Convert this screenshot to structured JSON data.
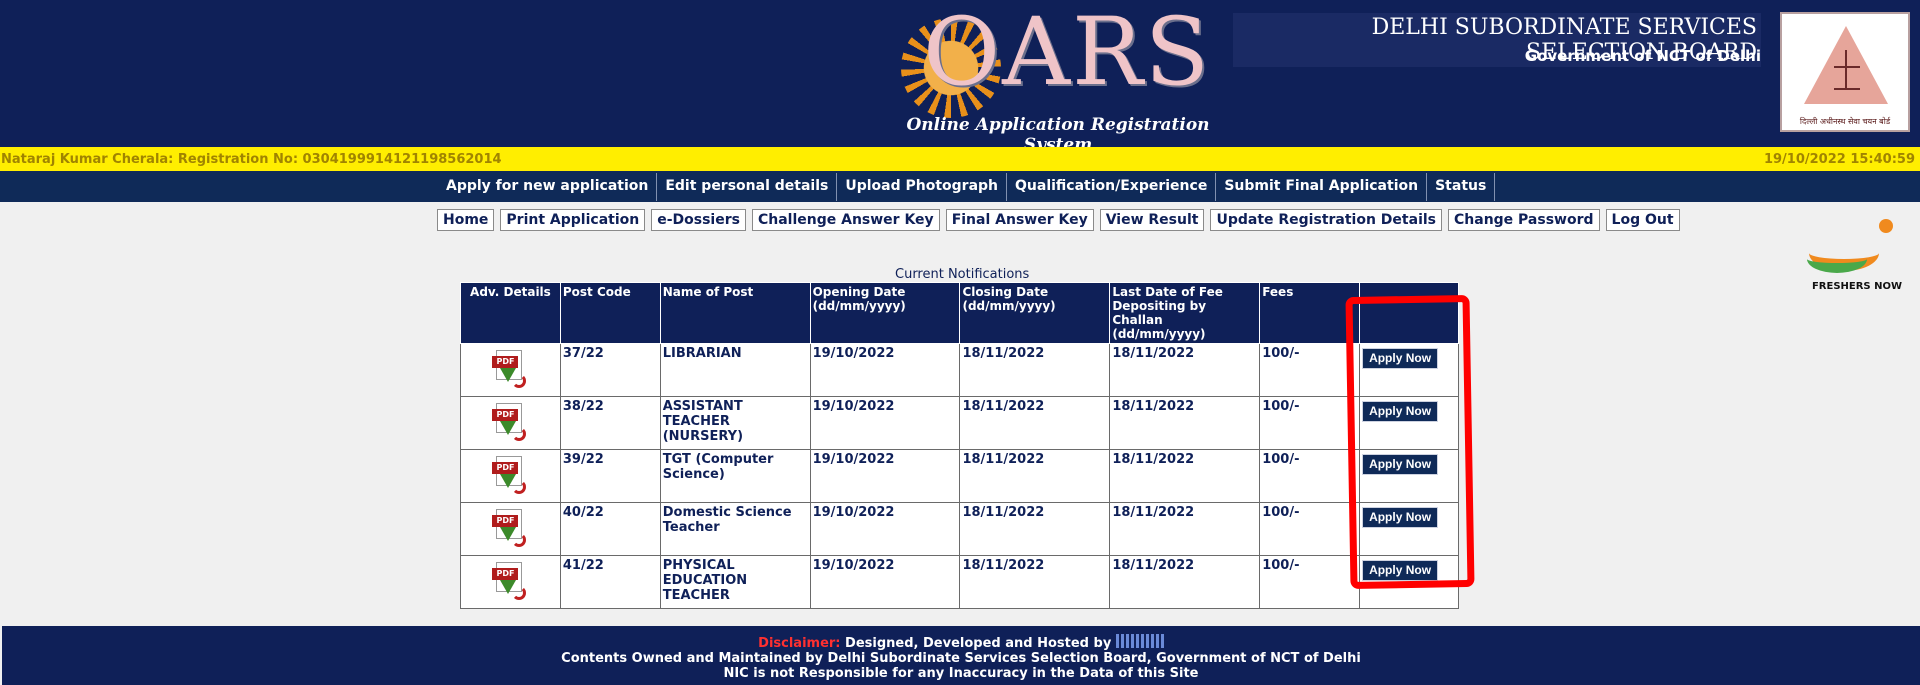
{
  "header": {
    "logo_text": "OARS",
    "logo_subtitle": "Online Application Registration System",
    "board_title": "DELHI SUBORDINATE SERVICES SELECTION BOARD",
    "board_subtitle": "Government of NCT of Delhi",
    "emblem_text": "दिल्ली अधीनस्थ सेवा चयन बोर्ड"
  },
  "userbar": {
    "user_info": "Nataraj Kumar Cherala: Registration No: 030419991412119856201​4",
    "datetime": "19/10/2022 15:40:59"
  },
  "main_nav": [
    "Apply for new application",
    "Edit personal details",
    "Upload Photograph",
    "Qualification/Experience",
    "Submit Final Application",
    "Status"
  ],
  "sub_nav": [
    "Home",
    "Print Application",
    "e-Dossiers",
    "Challenge Answer Key",
    "Final Answer Key",
    "View Result",
    "Update Registration Details",
    "Change Password",
    "Log Out"
  ],
  "watermark": "FRESHERS NOW",
  "notifications": {
    "title": "Current Notifications",
    "columns": [
      "Adv. Details",
      "Post Code",
      "Name of Post",
      "Opening Date (dd/mm/yyyy)",
      "Closing Date (dd/mm/yyyy)",
      "Last Date of Fee Depositing by Challan (dd/mm/yyyy)",
      "Fees",
      ""
    ],
    "pdf_label": "PDF",
    "apply_label": "Apply Now",
    "rows": [
      {
        "post_code": "37/22",
        "name": "LIBRARIAN",
        "opening": "19/10/2022",
        "closing": "18/11/2022",
        "fee_last": "18/11/2022",
        "fees": "100/-"
      },
      {
        "post_code": "38/22",
        "name": "ASSISTANT TEACHER (NURSERY)",
        "opening": "19/10/2022",
        "closing": "18/11/2022",
        "fee_last": "18/11/2022",
        "fees": "100/-"
      },
      {
        "post_code": "39/22",
        "name": "TGT (Computer Science)",
        "opening": "19/10/2022",
        "closing": "18/11/2022",
        "fee_last": "18/11/2022",
        "fees": "100/-"
      },
      {
        "post_code": "40/22",
        "name": "Domestic Science Teacher",
        "opening": "19/10/2022",
        "closing": "18/11/2022",
        "fee_last": "18/11/2022",
        "fees": "100/-"
      },
      {
        "post_code": "41/22",
        "name": "PHYSICAL EDUCATION TEACHER",
        "opening": "19/10/2022",
        "closing": "18/11/2022",
        "fee_last": "18/11/2022",
        "fees": "100/-"
      }
    ]
  },
  "footer": {
    "disclaimer_label": "Disclaimer:",
    "line1": "Designed, Developed and Hosted by",
    "line2": "Contents Owned and Maintained by Delhi Subordinate Services Selection Board, Government of NCT of Delhi",
    "line3": "NIC is not Responsible for any Inaccuracy in the Data of this Site"
  }
}
